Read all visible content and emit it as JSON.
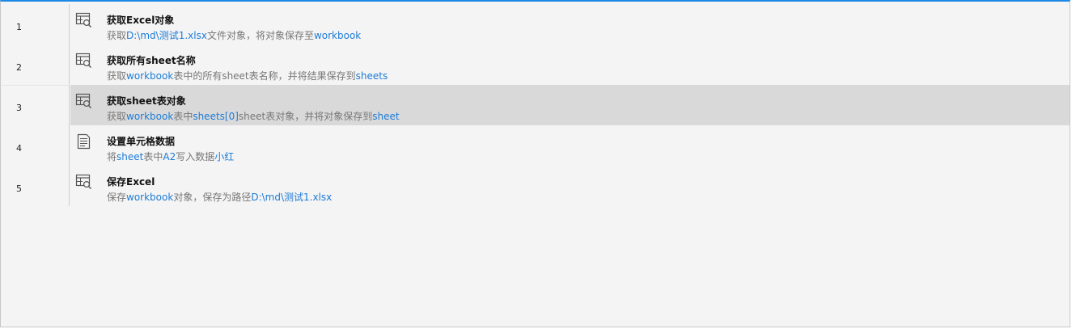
{
  "colors": {
    "accent": "#1e88e5",
    "link": "#1e7bd6",
    "selected_row": "#d9d9d9",
    "background": "#f4f4f4"
  },
  "steps": [
    {
      "number": "1",
      "icon": "excel-table-search-icon",
      "title": "获取Excel对象",
      "desc": [
        {
          "text": "获取",
          "hl": false
        },
        {
          "text": "D:\\md\\测试1.xlsx",
          "hl": true
        },
        {
          "text": "文件对象，将对象保存至",
          "hl": false
        },
        {
          "text": "workbook",
          "hl": true
        }
      ],
      "selected": false
    },
    {
      "number": "2",
      "icon": "excel-table-search-icon",
      "title": "获取所有sheet名称",
      "desc": [
        {
          "text": "获取",
          "hl": false
        },
        {
          "text": "workbook",
          "hl": true
        },
        {
          "text": "表中的所有sheet表名称，并将结果保存到",
          "hl": false
        },
        {
          "text": "sheets",
          "hl": true
        }
      ],
      "selected": false
    },
    {
      "number": "3",
      "icon": "excel-table-search-icon",
      "title": "获取sheet表对象",
      "desc": [
        {
          "text": "获取",
          "hl": false
        },
        {
          "text": "workbook",
          "hl": true
        },
        {
          "text": "表中",
          "hl": false
        },
        {
          "text": "sheets[0]",
          "hl": true
        },
        {
          "text": "sheet表对象，并将对象保存到",
          "hl": false
        },
        {
          "text": "sheet",
          "hl": true
        }
      ],
      "selected": true
    },
    {
      "number": "4",
      "icon": "document-lines-icon",
      "title": "设置单元格数据",
      "desc": [
        {
          "text": "将",
          "hl": false
        },
        {
          "text": "sheet",
          "hl": true
        },
        {
          "text": "表中",
          "hl": false
        },
        {
          "text": "A2",
          "hl": true
        },
        {
          "text": "写入数据",
          "hl": false
        },
        {
          "text": "小红",
          "hl": true
        }
      ],
      "selected": false
    },
    {
      "number": "5",
      "icon": "excel-table-search-icon",
      "title": "保存Excel",
      "desc": [
        {
          "text": "保存",
          "hl": false
        },
        {
          "text": "workbook",
          "hl": true
        },
        {
          "text": "对象，保存为路径",
          "hl": false
        },
        {
          "text": "D:\\md\\测试1.xlsx",
          "hl": true
        }
      ],
      "selected": false
    }
  ]
}
